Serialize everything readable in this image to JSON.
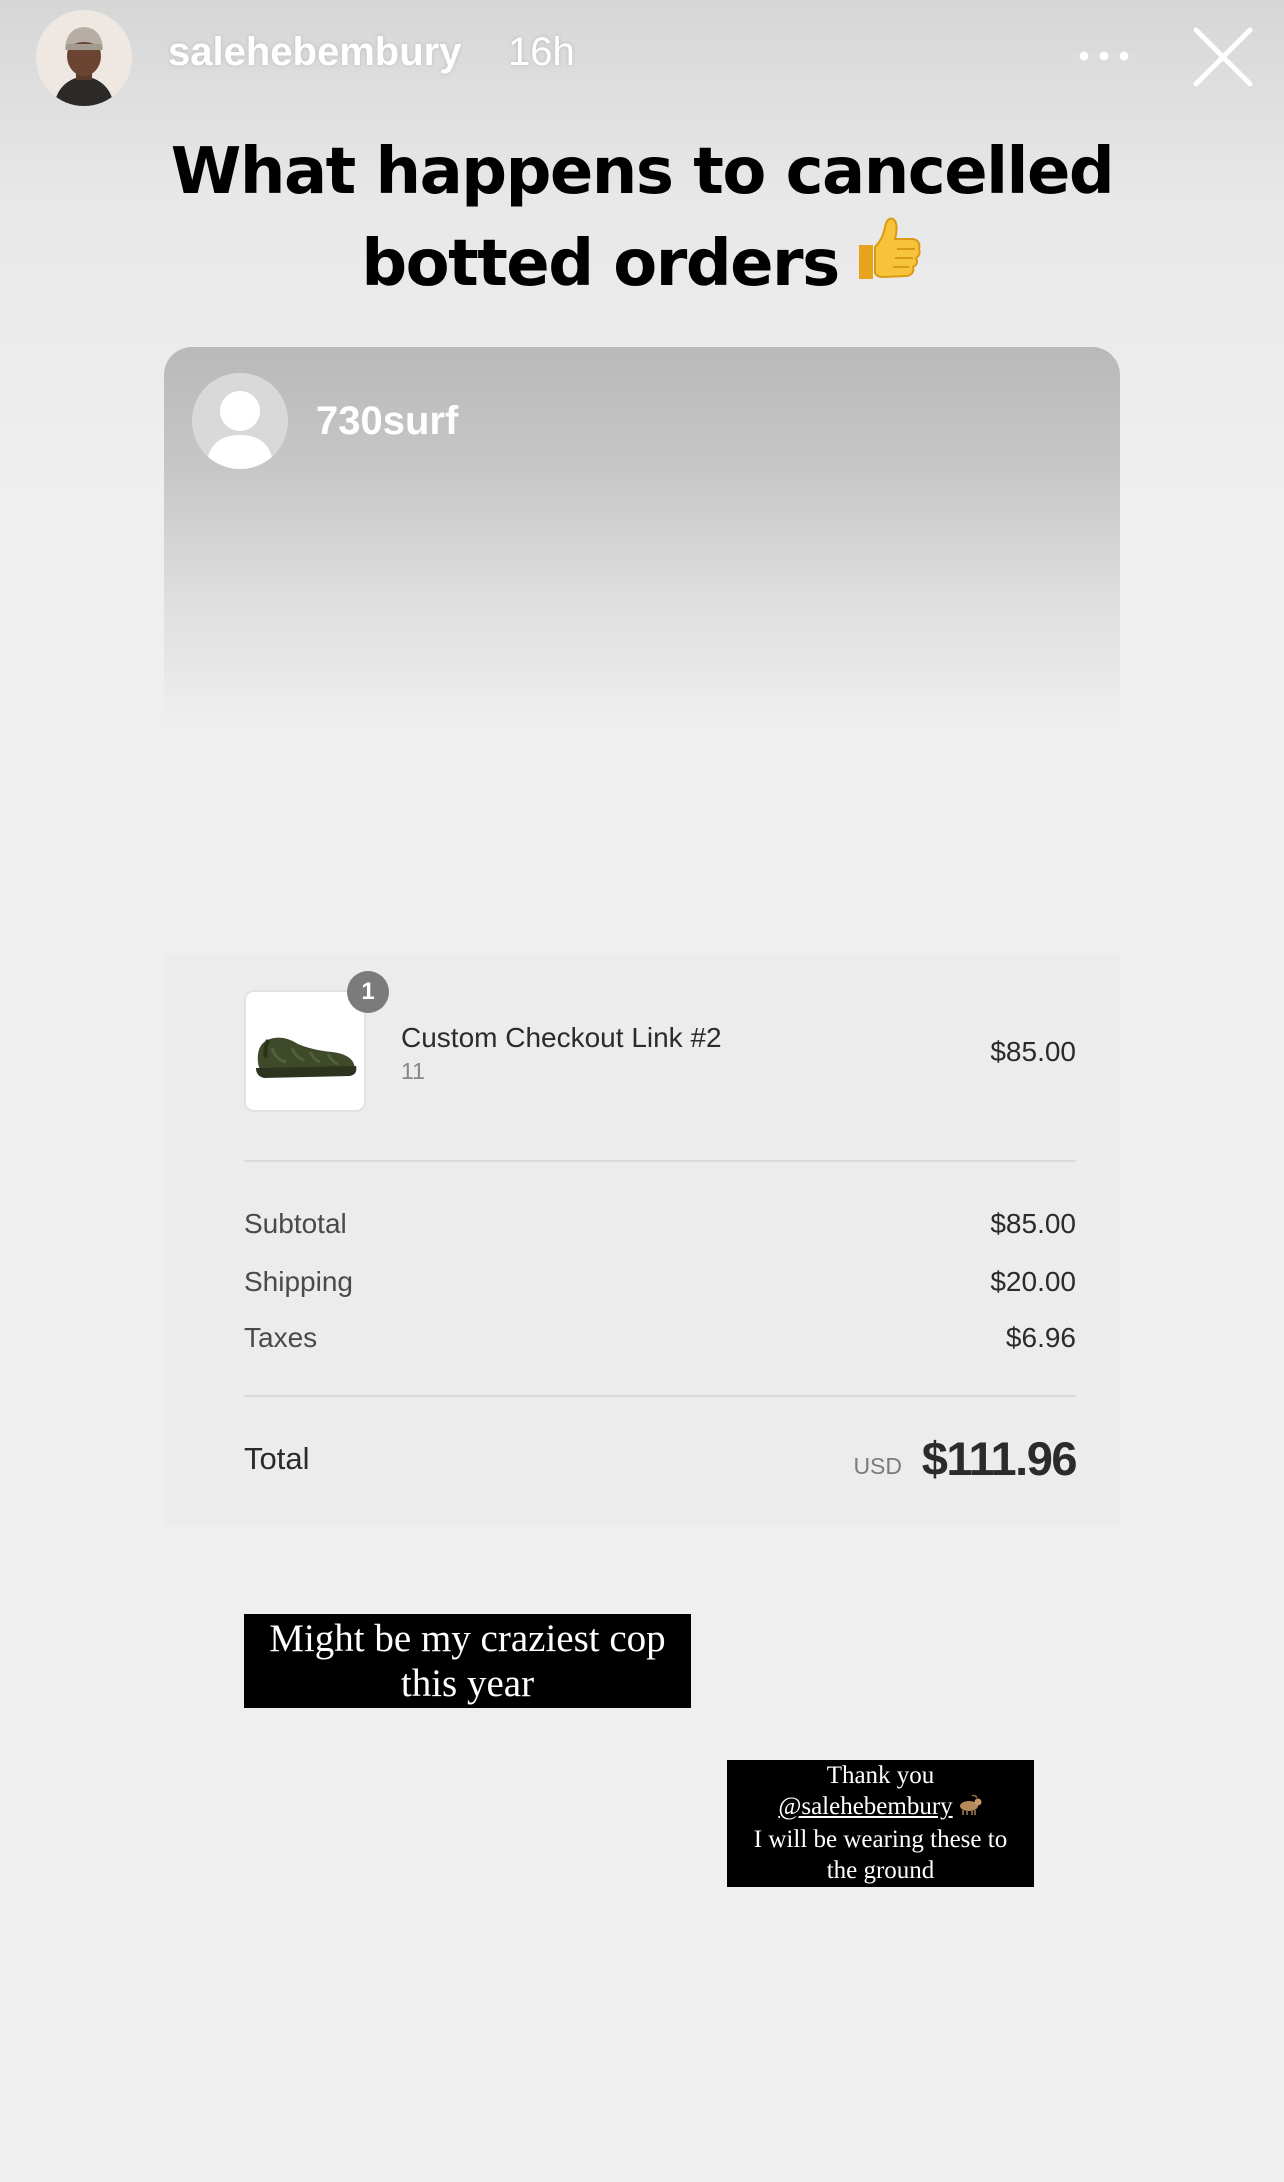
{
  "header": {
    "username": "salehebembury",
    "time_ago": "16h"
  },
  "headline": {
    "line1": "What happens to cancelled",
    "line2": "botted orders"
  },
  "shared_post": {
    "username": "730surf"
  },
  "receipt": {
    "item": {
      "quantity": "1",
      "name": "Custom Checkout Link #2",
      "variant": "11",
      "price": "$85.00"
    },
    "subtotal_label": "Subtotal",
    "subtotal_value": "$85.00",
    "shipping_label": "Shipping",
    "shipping_value": "$20.00",
    "taxes_label": "Taxes",
    "taxes_value": "$6.96",
    "total_label": "Total",
    "currency": "USD",
    "total_value": "$111.96"
  },
  "captions": {
    "first_line1": "Might be my craziest cop",
    "first_line2": "this year",
    "second_line1": "Thank you",
    "second_mention": "@salehebembury",
    "second_line3": "I will be wearing these to",
    "second_line4": "the ground"
  },
  "icons": {
    "more": "more-horizontal-icon",
    "close": "close-icon",
    "thumbs_up": "thumbs-up-emoji",
    "goat": "goat-emoji"
  }
}
